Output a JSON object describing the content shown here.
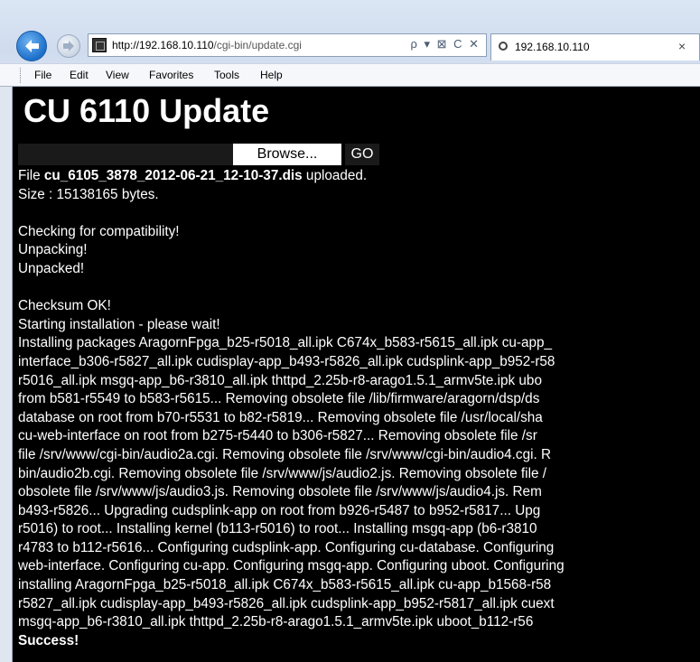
{
  "browser": {
    "url_host": "http://192.168.10.110",
    "url_path": "/cgi-bin/update.cgi",
    "address_tools": "ρ ▾ ⊠ C ✕",
    "tab_title": "192.168.10.110",
    "tab_close": "×"
  },
  "menu": [
    "File",
    "Edit",
    "View",
    "Favorites",
    "Tools",
    "Help"
  ],
  "page": {
    "title": "CU 6110 Update",
    "browse_label": "Browse...",
    "go_label": "GO",
    "file_prefix": "File ",
    "file_name": "cu_6105_3878_2012-06-21_12-10-37.dis",
    "file_suffix": " uploaded.",
    "size_line": "Size : 15138165 bytes.",
    "log_a": [
      "Checking for compatibility!",
      "Unpacking!",
      "Unpacked!"
    ],
    "log_b": [
      "Checksum OK!",
      "Starting installation - please wait!",
      "Installing packages AragornFpga_b25-r5018_all.ipk C674x_b583-r5615_all.ipk cu-app_",
      "interface_b306-r5827_all.ipk cudisplay-app_b493-r5826_all.ipk cudsplink-app_b952-r58",
      "r5016_all.ipk msgq-app_b6-r3810_all.ipk thttpd_2.25b-r8-arago1.5.1_armv5te.ipk ubo",
      "from b581-r5549 to b583-r5615... Removing obsolete file /lib/firmware/aragorn/dsp/ds",
      "database on root from b70-r5531 to b82-r5819... Removing obsolete file /usr/local/sha",
      "cu-web-interface on root from b275-r5440 to b306-r5827... Removing obsolete file /sr",
      "file /srv/www/cgi-bin/audio2a.cgi. Removing obsolete file /srv/www/cgi-bin/audio4.cgi. R",
      "bin/audio2b.cgi. Removing obsolete file /srv/www/js/audio2.js. Removing obsolete file /",
      "obsolete file /srv/www/js/audio3.js. Removing obsolete file /srv/www/js/audio4.js. Rem",
      "b493-r5826... Upgrading cudsplink-app on root from b926-r5487 to b952-r5817... Upg",
      "r5016) to root... Installing kernel (b113-r5016) to root... Installing msgq-app (b6-r3810",
      "r4783 to b112-r5616... Configuring cudsplink-app. Configuring cu-database. Configuring",
      "web-interface. Configuring cu-app. Configuring msgq-app. Configuring uboot. Configuring",
      "installing AragornFpga_b25-r5018_all.ipk C674x_b583-r5615_all.ipk cu-app_b1568-r58",
      "r5827_all.ipk cudisplay-app_b493-r5826_all.ipk cudsplink-app_b952-r5817_all.ipk cuext",
      "msgq-app_b6-r3810_all.ipk thttpd_2.25b-r8-arago1.5.1_armv5te.ipk uboot_b112-r56"
    ],
    "success": "Success!"
  }
}
